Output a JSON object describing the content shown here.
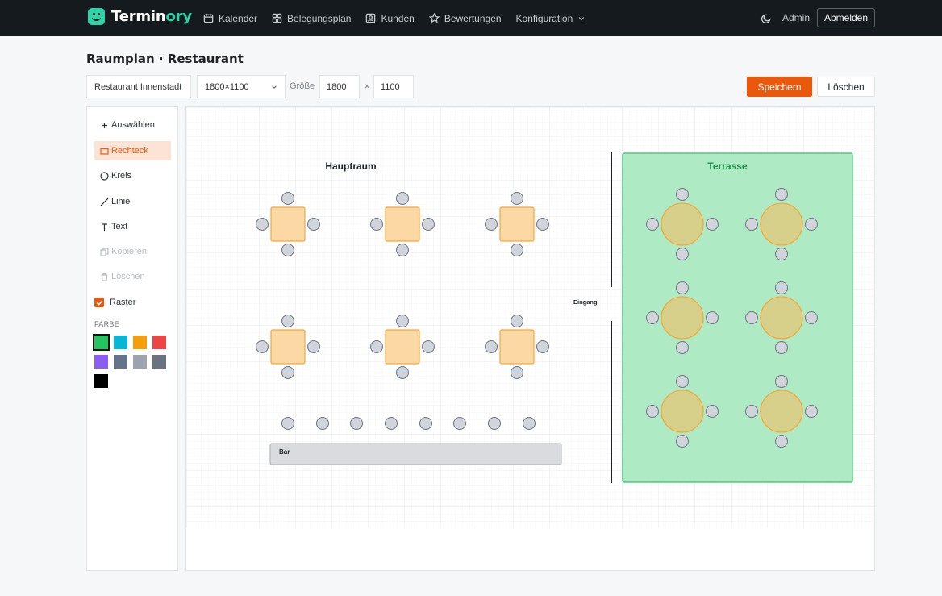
{
  "brand": {
    "name_part1": "Termin",
    "name_part2": "ory",
    "accent": "#2dd4a7"
  },
  "nav": [
    {
      "label": "Kalender",
      "icon": "calendar-icon"
    },
    {
      "label": "Belegungsplan",
      "icon": "grid-icon"
    },
    {
      "label": "Kunden",
      "icon": "contact-card-icon"
    },
    {
      "label": "Bewertungen",
      "icon": "star-icon"
    },
    {
      "label": "Konfiguration",
      "icon": "chevron-down-icon"
    }
  ],
  "user": {
    "name": "Admin",
    "logout_label": "Abmelden"
  },
  "page": {
    "title": "Raumplan · Restaurant"
  },
  "toolbar": {
    "room": "Restaurant Innenstadt",
    "size_preset": "1800×1100",
    "size_label": "Größe",
    "width": "1800",
    "times": "×",
    "height": "1100",
    "save_label": "Speichern",
    "delete_label": "Löschen",
    "save_color": "#ea580c"
  },
  "tools": [
    {
      "label": "Auswählen",
      "icon": "move-icon",
      "state": "normal"
    },
    {
      "label": "Rechteck",
      "icon": "rectangle-icon",
      "state": "active"
    },
    {
      "label": "Kreis",
      "icon": "circle-icon",
      "state": "normal"
    },
    {
      "label": "Linie",
      "icon": "line-icon",
      "state": "normal"
    },
    {
      "label": "Text",
      "icon": "text-icon",
      "state": "normal"
    },
    {
      "label": "Kopieren",
      "icon": "copy-icon",
      "state": "disabled"
    },
    {
      "label": "Löschen",
      "icon": "trash-icon",
      "state": "disabled"
    }
  ],
  "grid": {
    "label": "Raster",
    "checked": true
  },
  "colors": {
    "label": "FARBE",
    "swatches": [
      "#22c55e",
      "#06b6d4",
      "#f59e0b",
      "#ef4444",
      "#8b5cf6",
      "#64748b",
      "#9ca3af",
      "#6b7280",
      "#000000"
    ],
    "selected_index": 0
  },
  "floorplan": {
    "main_room_label": "Hauptraum",
    "terrace_label": "Terrasse",
    "entrance_label": "Eingang",
    "bar_label": "Bar",
    "table_fill": "#fcd9a4",
    "table_stroke": "#f2a93b",
    "terrace_fill": "#aeeac4",
    "terrace_stroke": "#34c06b",
    "seat_fill": "#d1d5db",
    "seat_stroke": "#6b7280"
  }
}
